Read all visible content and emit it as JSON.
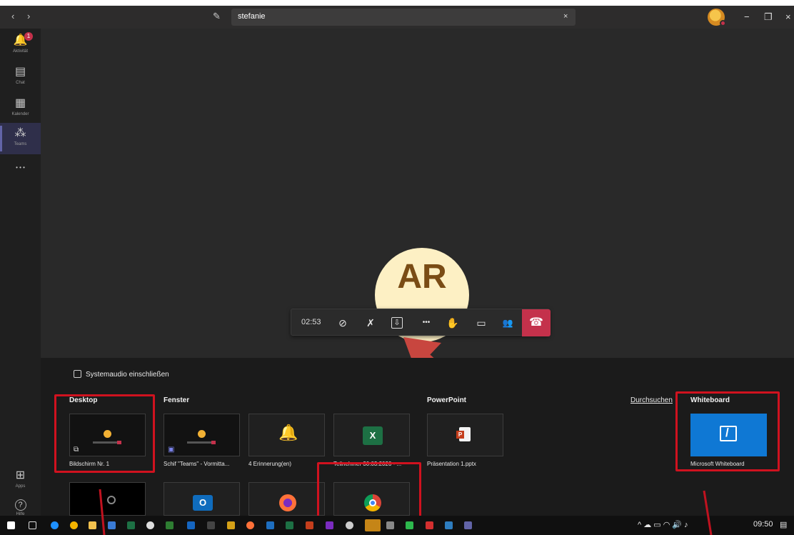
{
  "titlebar": {
    "back_glyph": "‹",
    "forward_glyph": "›",
    "compose_icon": "compose-icon",
    "search_value": "stefanie",
    "clear_glyph": "×",
    "minimize_glyph": "−",
    "restore_glyph": "❐",
    "close_glyph": "×"
  },
  "rail": {
    "items": [
      {
        "label": "Aktivität",
        "icon": "bell-icon",
        "glyph": "🔔",
        "badge": "1"
      },
      {
        "label": "Chat",
        "icon": "chat-icon",
        "glyph": "▤"
      },
      {
        "label": "Kalender",
        "icon": "calendar-icon",
        "glyph": "▦"
      },
      {
        "label": "Teams",
        "icon": "teams-icon",
        "glyph": "⁂"
      }
    ],
    "more_glyph": "• • •",
    "apps_label": "Apps",
    "apps_glyph": "⊞",
    "help_label": "Hilfe",
    "help_glyph": "?"
  },
  "call": {
    "avatar_initials": "AR",
    "timer": "02:53",
    "controls": [
      {
        "icon": "camera-off-icon",
        "glyph": "⊘"
      },
      {
        "icon": "mic-off-icon",
        "glyph": "✗"
      },
      {
        "icon": "share-tray-icon",
        "glyph": "⇩"
      },
      {
        "icon": "more-options-icon",
        "glyph": "•••"
      },
      {
        "icon": "raise-hand-icon",
        "glyph": "✋"
      },
      {
        "icon": "chat-bubble-icon",
        "glyph": "▭"
      },
      {
        "icon": "participants-icon",
        "glyph": "👥"
      }
    ],
    "hangup_glyph": "☎"
  },
  "share": {
    "system_audio_label": "Systemaudio einschließen",
    "sections": {
      "desktop": "Desktop",
      "window": "Fenster",
      "powerpoint": "PowerPoint",
      "browse": "Durchsuchen",
      "whiteboard": "Whiteboard"
    },
    "tiles": {
      "screen1": "Bildschirm Nr. 1",
      "teams_window": "Schif \"Teams\" - Vormitta...",
      "reminders": "4 Erinnerung(en)",
      "excel": "Teilnehmer 30.03.2020 - ...",
      "ppt_file": "Präsentation 1.pptx",
      "whiteboard_app": "Microsoft Whiteboard"
    },
    "app_letters": {
      "excel": "X",
      "outlook": "O"
    }
  },
  "taskbar": {
    "time": "09:50",
    "tray_glyphs": "^  ☁  ▭  ◠  🔊  ♪",
    "notification_glyph": "▤"
  },
  "colors": {
    "teams_purple": "#6264a7",
    "hangup_red": "#c4314b",
    "highlight_red": "#d0121f",
    "whiteboard_blue": "#0f78d4"
  }
}
